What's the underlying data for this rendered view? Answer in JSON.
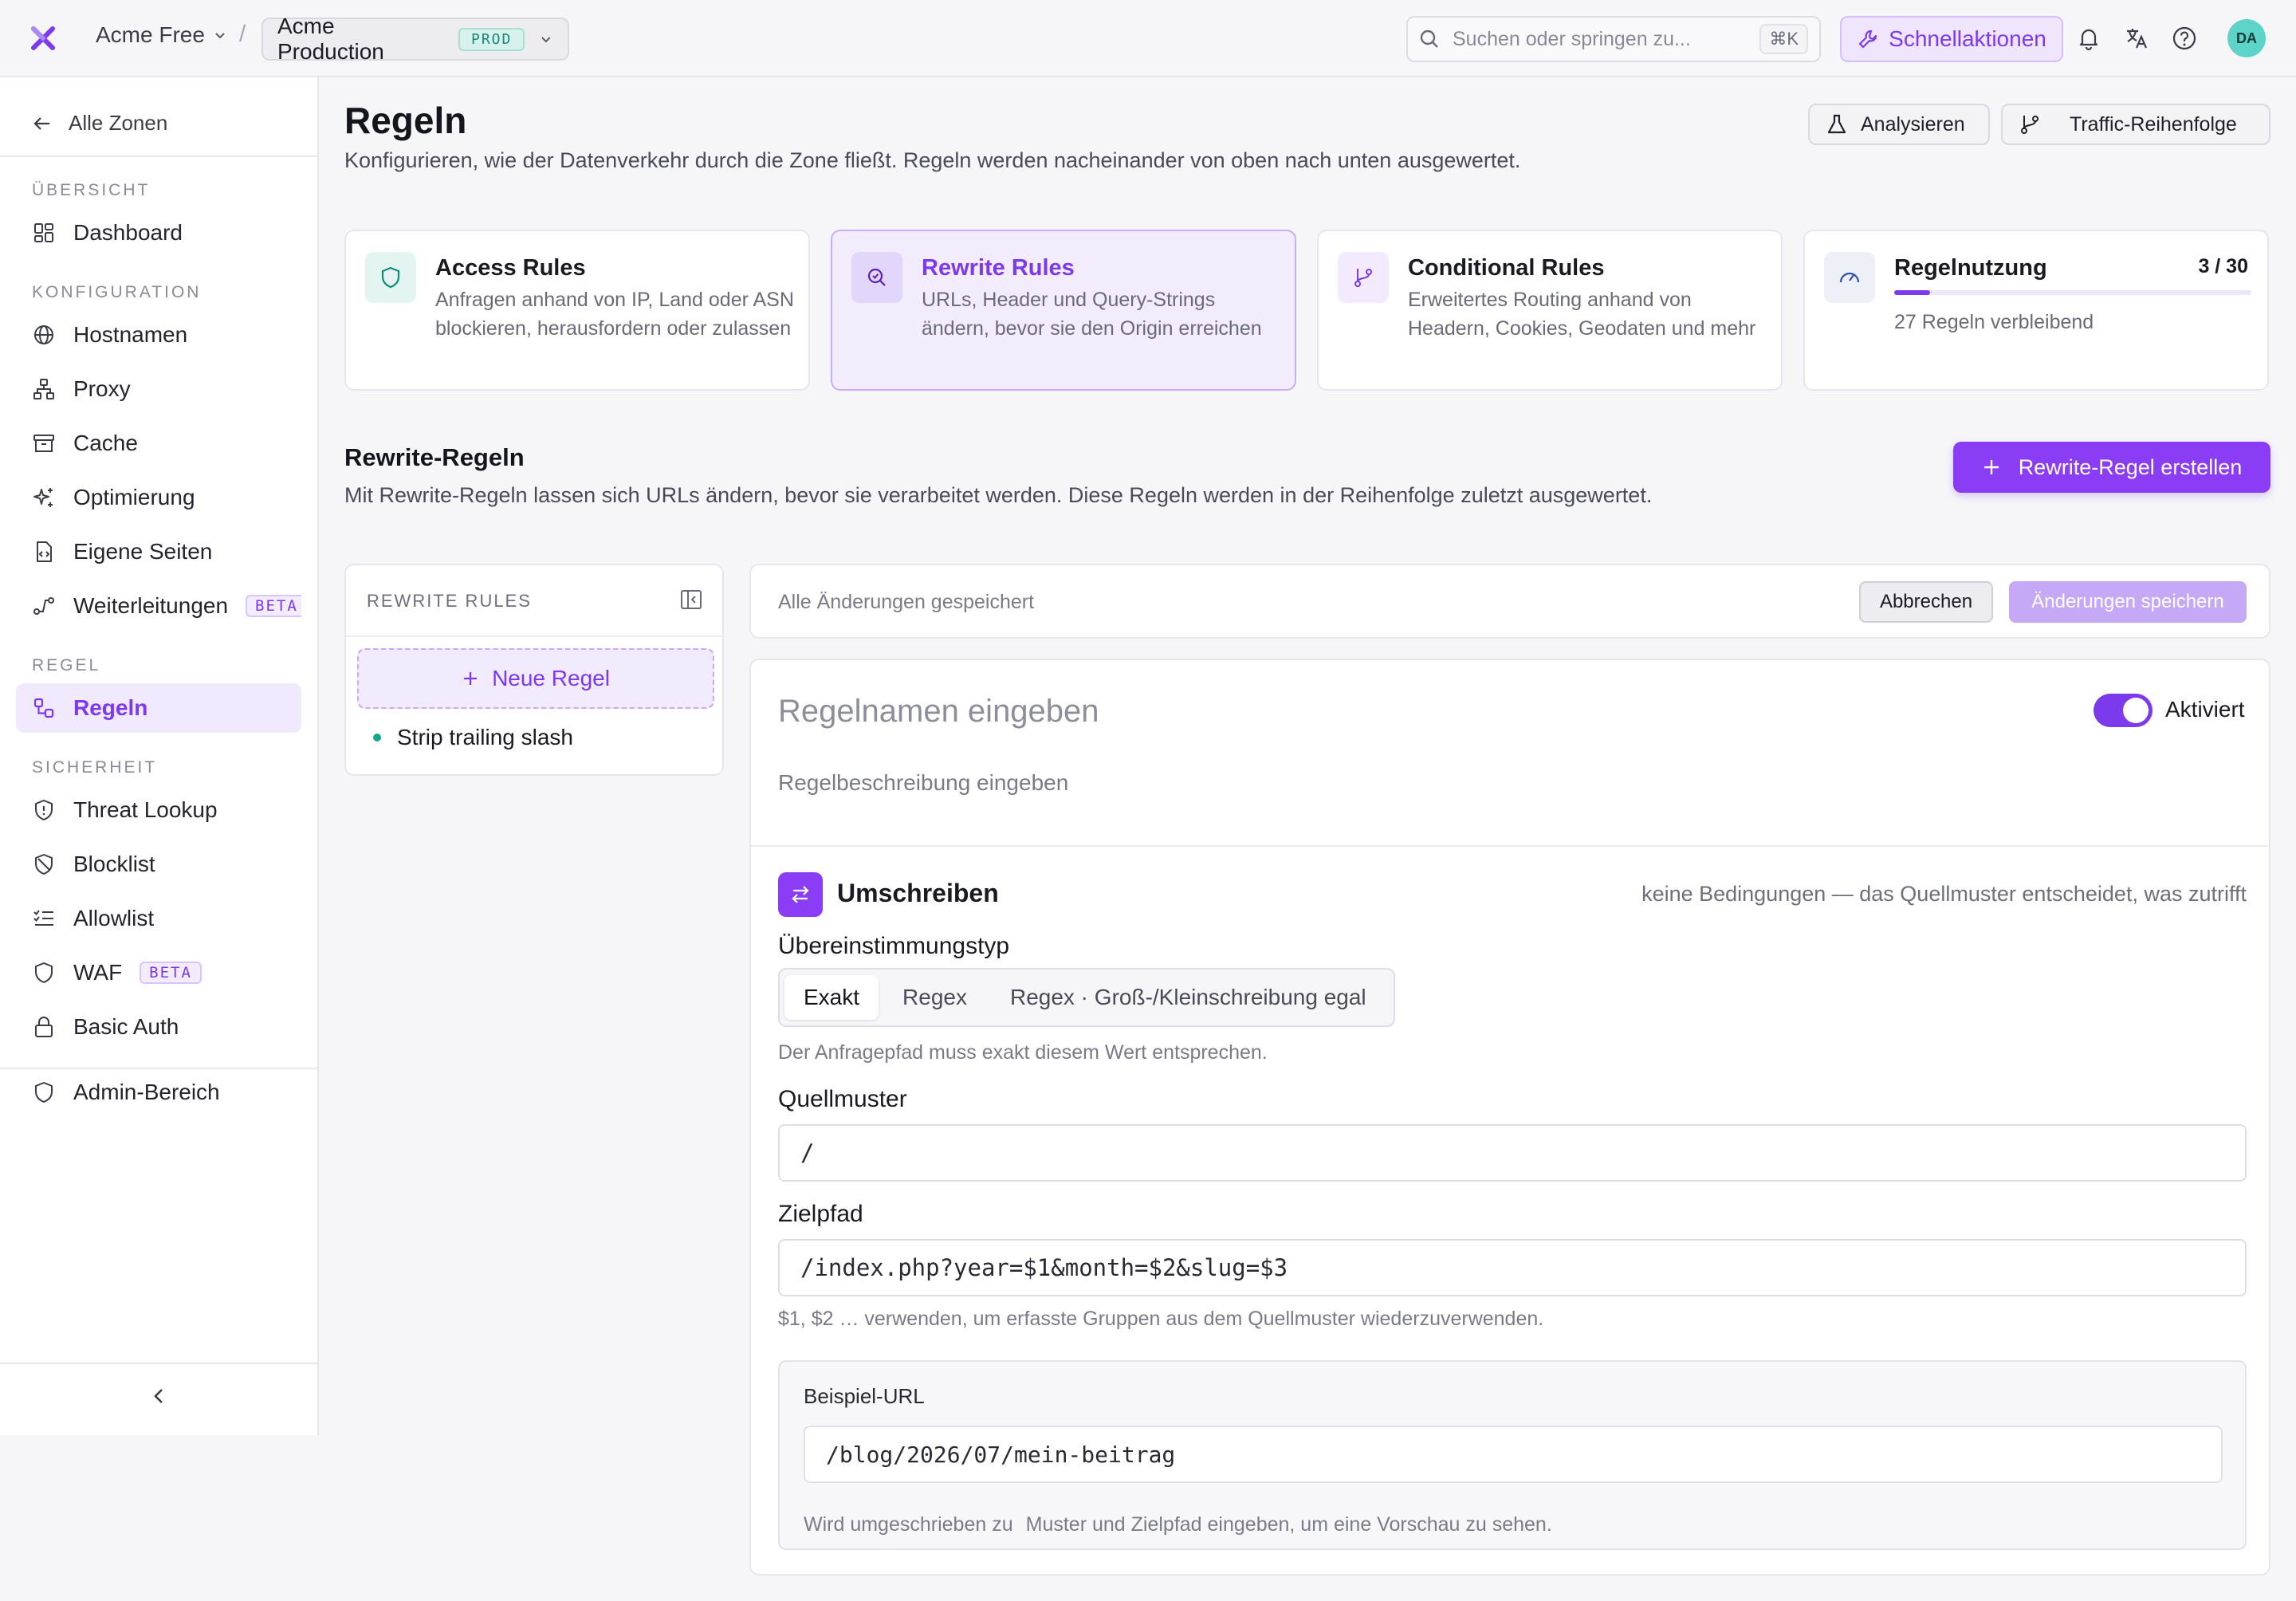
{
  "topbar": {
    "org_name": "Acme Free",
    "breadcrumb_separator": "/",
    "zone_name": "Acme Production",
    "zone_badge": "PROD",
    "search_placeholder": "Suchen oder springen zu...",
    "search_shortcut": "⌘K",
    "quick_actions_label": "Schnellaktionen",
    "avatar_initials": "DA",
    "accent_color": "#7c3aed"
  },
  "sidebar": {
    "back_label": "Alle Zonen",
    "sections": {
      "overview": "ÜBERSICHT",
      "config": "KONFIGURATION",
      "rule": "REGEL",
      "security": "SICHERHEIT"
    },
    "items": {
      "dashboard": "Dashboard",
      "hostnames": "Hostnamen",
      "proxy": "Proxy",
      "cache": "Cache",
      "optimization": "Optimierung",
      "custom_pages": "Eigene Seiten",
      "redirects": "Weiterleitungen",
      "redirects_badge": "BETA",
      "rules": "Regeln",
      "threat_lookup": "Threat Lookup",
      "blocklist": "Blocklist",
      "allowlist": "Allowlist",
      "waf": "WAF",
      "waf_badge": "BETA",
      "basic_auth": "Basic Auth",
      "admin": "Admin-Bereich"
    }
  },
  "header": {
    "title": "Regeln",
    "subtitle": "Konfigurieren, wie der Datenverkehr durch die Zone fließt. Regeln werden nacheinander von oben nach unten ausgewertet.",
    "analyze_label": "Analysieren",
    "traffic_order_label": "Traffic-Reihenfolge"
  },
  "cards": {
    "access": {
      "title": "Access Rules",
      "desc": "Anfragen anhand von IP, Land oder ASN blockieren, herausfordern oder zulassen"
    },
    "rewrite": {
      "title": "Rewrite Rules",
      "desc": "URLs, Header und Query-Strings ändern, bevor sie den Origin erreichen"
    },
    "conditional": {
      "title": "Conditional Rules",
      "desc": "Erweitertes Routing anhand von Headern, Cookies, Geodaten und mehr"
    },
    "usage": {
      "title": "Regelnutzung",
      "count": "3 / 30",
      "used": 3,
      "limit": 30,
      "remaining": "27 Regeln verbleibend"
    }
  },
  "rewrite_section": {
    "title": "Rewrite-Regeln",
    "subtitle": "Mit Rewrite-Regeln lassen sich URLs ändern, bevor sie verarbeitet werden. Diese Regeln werden in der Reihenfolge zuletzt ausgewertet.",
    "create_label": "Rewrite-Regel erstellen"
  },
  "rule_list": {
    "heading": "REWRITE RULES",
    "new_rule_label": "Neue Regel",
    "rules": [
      "Strip trailing slash"
    ]
  },
  "save_bar": {
    "status": "Alle Änderungen gespeichert",
    "cancel_label": "Abbrechen",
    "save_label": "Änderungen speichern"
  },
  "editor": {
    "name_placeholder": "Regelnamen eingeben",
    "enabled_label": "Aktiviert",
    "enabled": true,
    "desc_placeholder": "Regelbeschreibung eingeben",
    "section_title": "Umschreiben",
    "section_note": "keine Bedingungen — das Quellmuster entscheidet, was zutrifft",
    "match_type_label": "Übereinstimmungstyp",
    "match_options": [
      "Exakt",
      "Regex",
      "Regex · Groß-/Kleinschreibung egal"
    ],
    "match_selected": "Exakt",
    "match_hint": "Der Anfragepfad muss exakt diesem Wert entsprechen.",
    "source_label": "Quellmuster",
    "source_value": "/",
    "target_label": "Zielpfad",
    "target_value": "/index.php?year=$1&month=$2&slug=$3",
    "target_hint": "$1, $2 … verwenden, um erfasste Gruppen aus dem Quellmuster wiederzuverwenden.",
    "example_label": "Beispiel-URL",
    "example_value": "/blog/2026/07/mein-beitrag",
    "rewritten_to_label": "Wird umgeschrieben zu",
    "preview_hint": "Muster und Zielpfad eingeben, um eine Vorschau zu sehen."
  }
}
